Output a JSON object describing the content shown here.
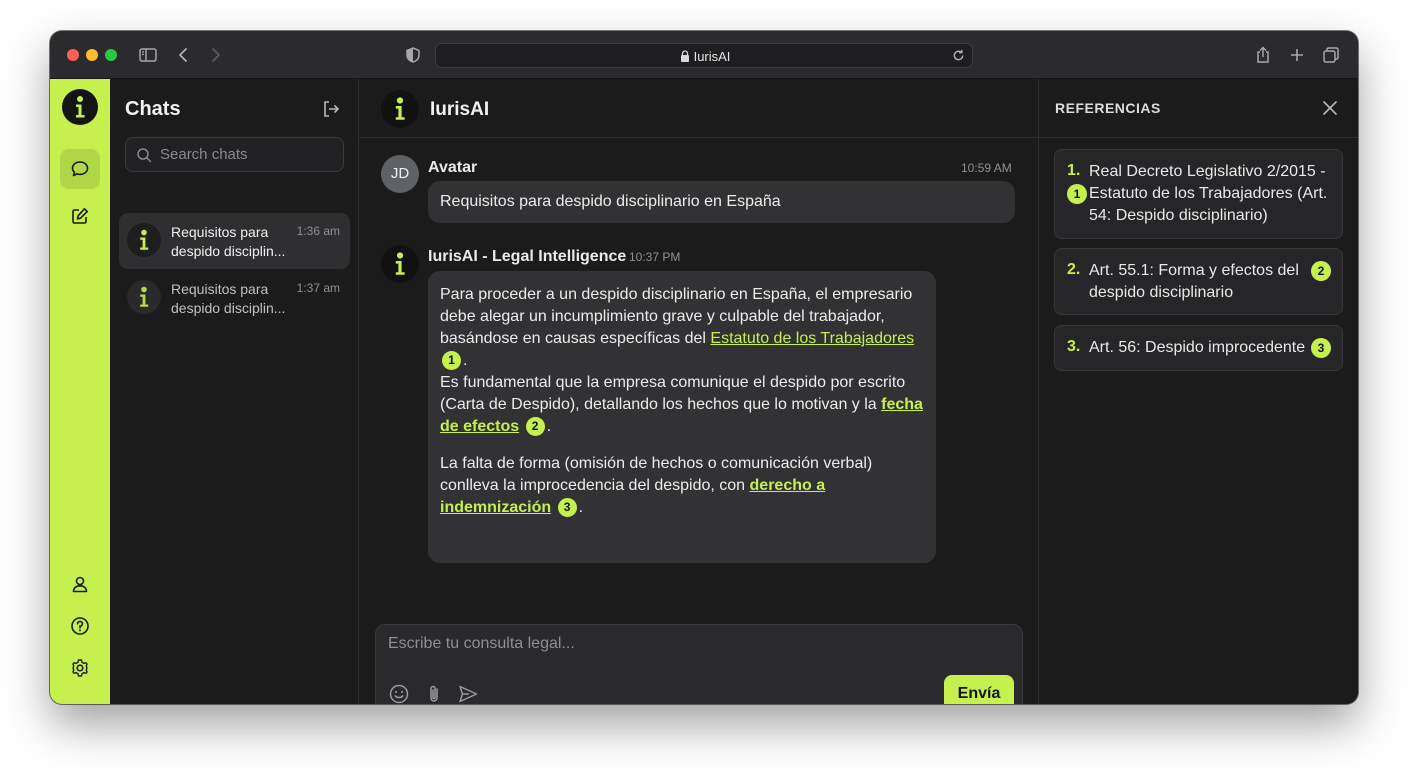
{
  "browser": {
    "url": "IurisAI"
  },
  "sidebar": {
    "title": "Chats",
    "search_placeholder": "Search chats",
    "chats": [
      {
        "title": "Requisitos para despido disciplin...",
        "time": "1:36 am"
      },
      {
        "title": "Requisitos para despido disciplin...",
        "time": "1:37 am"
      }
    ]
  },
  "header": {
    "title": "IurisAI"
  },
  "messages": {
    "user": {
      "avatar_initials": "JD",
      "name": "Avatar",
      "time": "10:59 AM",
      "text": "Requisitos para despido disciplinario en España"
    },
    "ai": {
      "name": "IurisAI - Legal Intelligence",
      "time": "10:37 PM",
      "p1_text": "Para proceder a un despido disciplinario en España, el empresario debe alegar un incumplimiento grave y culpable del trabajador, basándose en causas específicas del ",
      "p1_link": "Estatuto de los Trabajadores",
      "p1_cite": "1",
      "p1_text2": "Es fundamental que la empresa comunique el despido por escrito (Carta de Despido), detallando los hechos que lo motivan y la ",
      "p1_link2": "fecha de efectos",
      "p1_cite2": "2",
      "p2_text": "La falta de forma (omisión de hechos o comunicación verbal) conlleva la improcedencia del despido, con ",
      "p2_link": "derecho a indemnización",
      "p2_cite": "3"
    }
  },
  "composer": {
    "placeholder": "Escribe tu consulta legal...",
    "send_label": "Envía"
  },
  "references": {
    "title": "REFERENCIAS",
    "items": [
      {
        "num": "1.",
        "line1": "Real Decreto Legislativo 2/2015 -",
        "line2": "Estatuto de los Trabajadores (Art.",
        "line3": "54: Despido disciplinario)",
        "cite": "1"
      },
      {
        "num": "2.",
        "line1": "Art. 55.1: Forma y efectos del",
        "line2": "despido disciplinario",
        "cite": "2"
      },
      {
        "num": "3.",
        "line1": "Art. 56: Despido improcedente",
        "cite": "3"
      }
    ]
  },
  "colors": {
    "accent": "#c5f04d",
    "background": "#1b1b1c",
    "bubble": "#323234"
  }
}
